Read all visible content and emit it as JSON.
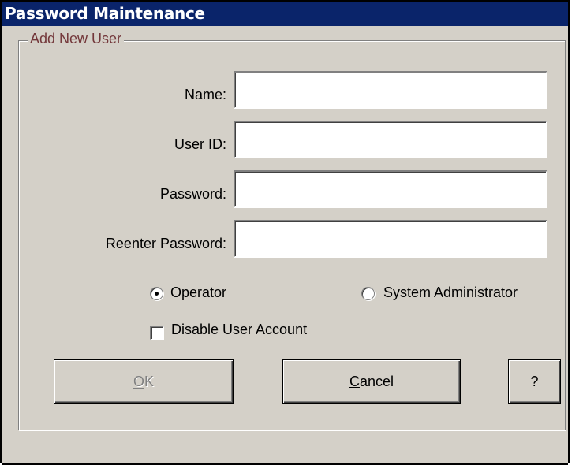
{
  "window": {
    "title": "Password Maintenance"
  },
  "group": {
    "legend": "Add New User"
  },
  "fields": {
    "name_label": "Name:",
    "name_value": "",
    "userid_label": "User ID:",
    "userid_value": "",
    "password_label": "Password:",
    "password_value": "",
    "reenter_label": "Reenter Password:",
    "reenter_value": ""
  },
  "role": {
    "operator_label": "Operator",
    "admin_label": "System Administrator",
    "selected": "Operator"
  },
  "disable_account": {
    "label": "Disable User Account",
    "checked": false
  },
  "buttons": {
    "ok_label": "OK",
    "ok_enabled": false,
    "cancel_label": "Cancel",
    "help_label": "?"
  },
  "colors": {
    "titlebar": "#0a246a",
    "face": "#d4d0c8",
    "legend_text": "#73373a"
  }
}
